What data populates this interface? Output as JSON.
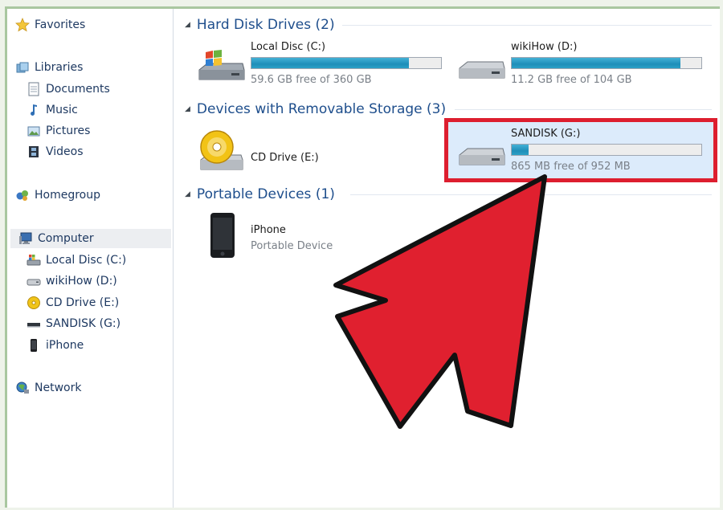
{
  "sidebar": {
    "favorites": "Favorites",
    "libraries": "Libraries",
    "library_items": [
      "Documents",
      "Music",
      "Pictures",
      "Videos"
    ],
    "homegroup": "Homegroup",
    "computer": "Computer",
    "computer_items": [
      "Local Disc (C:)",
      "wikiHow (D:)",
      "CD Drive (E:)",
      "SANDISK (G:)",
      "iPhone"
    ],
    "network": "Network"
  },
  "groups": {
    "hard_disk": {
      "title": "Hard Disk Drives (2)",
      "drives": [
        {
          "name": "Local Disc (C:)",
          "free": "59.6 GB free of 360 GB",
          "used_fraction": 0.83
        },
        {
          "name": "wikiHow (D:)",
          "free": "11.2 GB free of 104 GB",
          "used_fraction": 0.89
        }
      ]
    },
    "removable": {
      "title": "Devices with Removable Storage (3)",
      "cd": {
        "name": "CD Drive (E:)"
      },
      "sandisk": {
        "name": "SANDISK (G:)",
        "free": "865 MB free of 952 MB",
        "used_fraction": 0.09
      }
    },
    "portable": {
      "title": "Portable Devices (1)",
      "iphone": {
        "name": "iPhone",
        "type": "Portable Device"
      }
    }
  },
  "annotation": {
    "arrow_color": "#e0202f",
    "box_color": "#dd1e2f",
    "selection_color": "#dcebfb"
  }
}
